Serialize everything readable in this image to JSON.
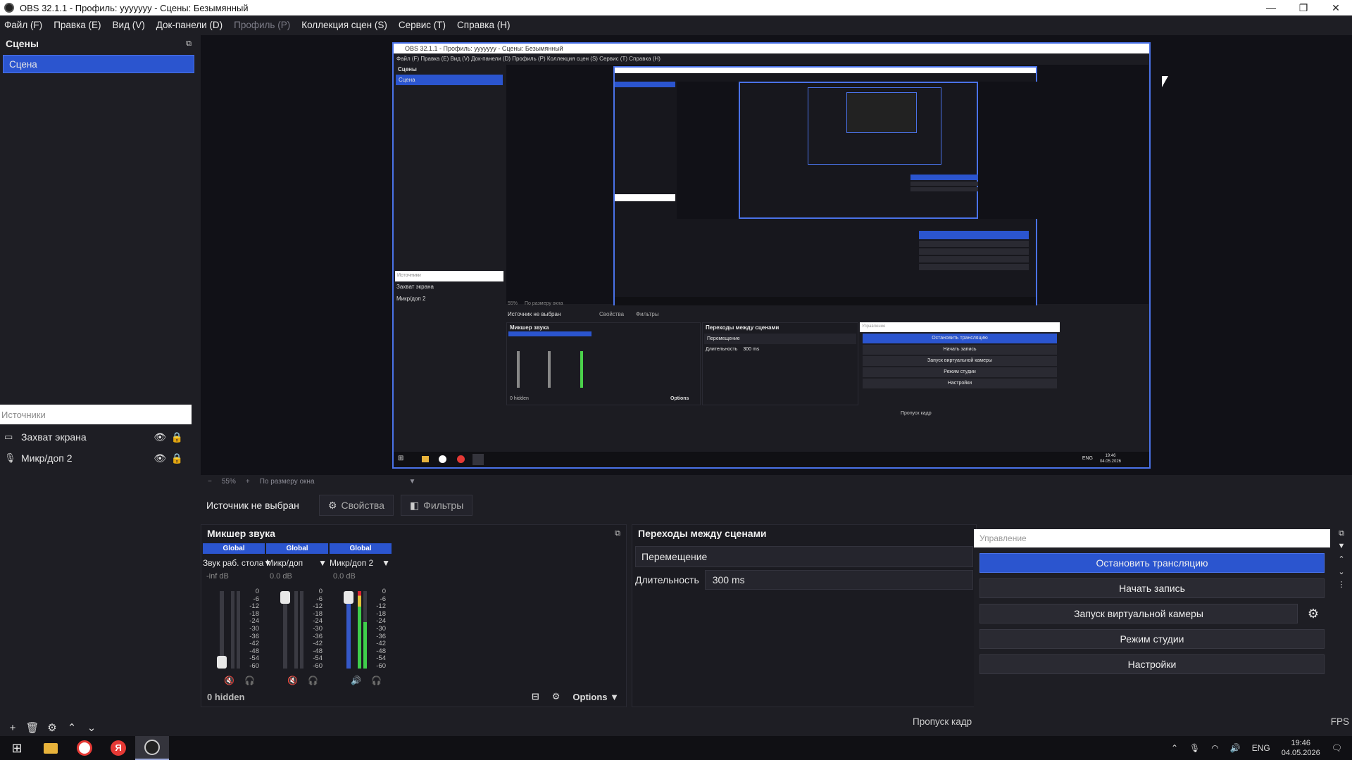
{
  "window": {
    "title": "OBS 32.1.1 - Профиль: yyyyyyy - Сцены: Безымянный",
    "controls": [
      "—",
      "❐",
      "✕"
    ]
  },
  "menu": [
    {
      "label": "Файл (F)",
      "disabled": false
    },
    {
      "label": "Правка (E)",
      "disabled": false
    },
    {
      "label": "Вид (V)",
      "disabled": false
    },
    {
      "label": "Док-панели (D)",
      "disabled": false
    },
    {
      "label": "Профиль (P)",
      "disabled": true
    },
    {
      "label": "Коллекция сцен (S)",
      "disabled": false
    },
    {
      "label": "Сервис (T)",
      "disabled": false
    },
    {
      "label": "Справка (H)",
      "disabled": false
    }
  ],
  "scenes": {
    "title": "Сцены",
    "items": [
      "Сцена"
    ]
  },
  "sources": {
    "title": "Источники",
    "items": [
      {
        "label": "Захват экрана",
        "icon": "monitor-icon"
      },
      {
        "label": "Микр/доп 2",
        "icon": "microphone-icon"
      }
    ]
  },
  "zoom": {
    "minus": "−",
    "value": "55%",
    "plus": "+",
    "mode": "По размеру окна"
  },
  "context": {
    "no_source": "Источник не выбран",
    "properties": "Свойства",
    "filters": "Фильтры"
  },
  "mixer": {
    "title": "Микшер звука",
    "channels": [
      {
        "badge": "Global",
        "name": "Звук раб. стола",
        "db": "-inf dB",
        "fader": 0.1
      },
      {
        "badge": "Global",
        "name": "Микр/доп",
        "db": "0.0 dB",
        "fader": 1.0
      },
      {
        "badge": "Global",
        "name": "Микр/доп 2",
        "db": "0.0 dB",
        "fader": 1.0
      }
    ],
    "scale": [
      "0",
      "-6",
      "-12",
      "-18",
      "-24",
      "-30",
      "-36",
      "-42",
      "-48",
      "-54",
      "-60"
    ],
    "hidden": "0 hidden",
    "options": "Options"
  },
  "transitions": {
    "title": "Переходы между сценами",
    "selected": "Перемещение",
    "duration_label": "Длительность",
    "duration_value": "300 ms"
  },
  "controls": {
    "title": "Управление",
    "buttons": [
      "Остановить трансляцию",
      "Начать запись",
      "Запуск виртуальной камеры",
      "Режим студии",
      "Настройки"
    ]
  },
  "status": {
    "dropped": "Пропуск кадр",
    "fps": "FPS"
  },
  "taskbar": {
    "lang": "ENG",
    "time": "19:46",
    "date": "04.05.2026"
  },
  "preview_inner": {
    "title": "OBS 32.1.1 - Профиль: yyyyyyy - Сцены: Безымянный",
    "menu": "Файл (F)   Правка (E)   Вид (V)   Док-панели (D)   Профиль (P)   Коллекция сцен (S)   Сервис (T)   Справка (H)",
    "scenes_title": "Сцены",
    "scene": "Сцена",
    "sources_title": "Источники",
    "src1": "Захват экрана",
    "src2": "Микр/доп 2",
    "no_source": "Источник не выбран",
    "props": "Свойства",
    "filters": "Фильтры",
    "mixer_title": "Микшер звука",
    "trans_title": "Переходы между сценами",
    "trans_sel": "Перемещение",
    "trans_dur": "Длительность",
    "trans_ms": "300 ms",
    "ctrl_title": "Управление",
    "b1": "Остановить трансляцию",
    "b2": "Начать запись",
    "b3": "Запуск виртуальной камеры",
    "b4": "Режим студии",
    "b5": "Настройки",
    "hidden": "0 hidden",
    "options": "Options",
    "dropped": "Пропуск кадр",
    "lang": "ENG",
    "time": "19:46",
    "date": "04.05.2026",
    "zoom": "55%",
    "fit": "По размеру окна"
  }
}
